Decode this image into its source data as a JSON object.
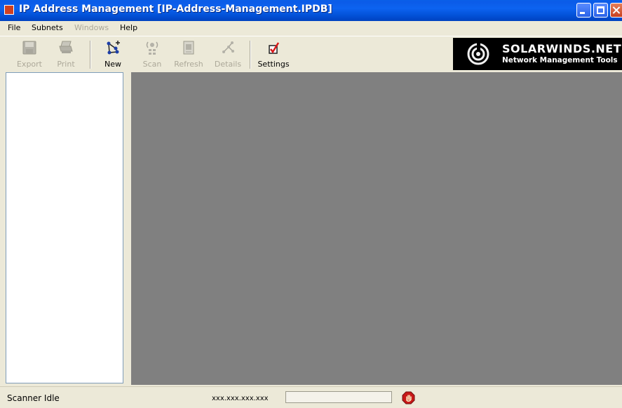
{
  "window": {
    "title": "IP Address Management [IP-Address-Management.IPDB]",
    "icons": {
      "app": "app-icon",
      "minimize": "minimize-icon",
      "maximize": "maximize-icon",
      "close": "close-icon"
    }
  },
  "menu": [
    {
      "label": "File",
      "enabled": true
    },
    {
      "label": "Subnets",
      "enabled": true
    },
    {
      "label": "Windows",
      "enabled": false
    },
    {
      "label": "Help",
      "enabled": true
    }
  ],
  "toolbar": {
    "export": {
      "label": "Export",
      "enabled": false,
      "icon": "floppy-disk-icon"
    },
    "print": {
      "label": "Print",
      "enabled": false,
      "icon": "printer-icon"
    },
    "new": {
      "label": "New",
      "enabled": true,
      "icon": "new-subnet-icon"
    },
    "scan": {
      "label": "Scan",
      "enabled": false,
      "icon": "scan-icon"
    },
    "refresh": {
      "label": "Refresh",
      "enabled": false,
      "icon": "refresh-icon"
    },
    "details": {
      "label": "Details",
      "enabled": false,
      "icon": "details-icon"
    },
    "settings": {
      "label": "Settings",
      "enabled": true,
      "icon": "settings-checkbox-icon"
    }
  },
  "logo": {
    "brand": "SOLARWINDS.NET",
    "tagline": "Network Management Tools",
    "icon": "solarwinds-swirl-icon"
  },
  "status": {
    "text": "Scanner Idle",
    "ip_mask": "xxx.xxx.xxx.xxx",
    "stop_icon": "stop-hand-icon"
  },
  "colors": {
    "titlebar": "#0a5ee8",
    "workspace": "#808080",
    "chrome": "#ece9d8",
    "disabled_text": "#aca899",
    "stop_red": "#c81818"
  }
}
